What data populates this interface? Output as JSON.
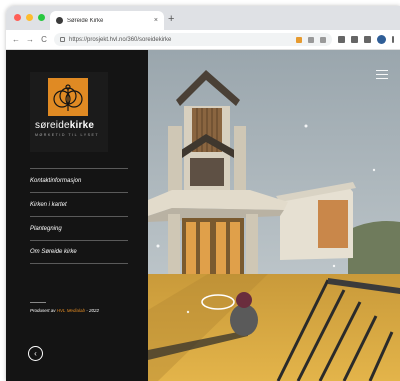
{
  "browser": {
    "tab_title": "Søreide Kirke",
    "tab_close": "×",
    "new_tab": "+",
    "url": "https://prosjekt.hvl.no/360/soreidekirke",
    "nav_back": "←",
    "nav_forward": "→",
    "nav_reload": "C"
  },
  "sidebar": {
    "logo_text_regular": "søreide",
    "logo_text_bold": "kirke",
    "logo_subtitle": "MØRKETID TIL LYSET",
    "menu_items": [
      {
        "label": "Kontaktinformasjon"
      },
      {
        "label": "Kirken i kartet"
      },
      {
        "label": "Plantegning"
      },
      {
        "label": "Om Søreide kirke"
      }
    ],
    "credit_prefix": "Produsert av ",
    "credit_link": "HVL Medialab",
    "credit_suffix": " - 2022",
    "back_symbol": "‹"
  },
  "colors": {
    "accent": "#e08a23",
    "sidebar_bg": "#141414",
    "traffic_red": "#ff5f57",
    "traffic_yellow": "#febc2e",
    "traffic_green": "#28c840"
  }
}
